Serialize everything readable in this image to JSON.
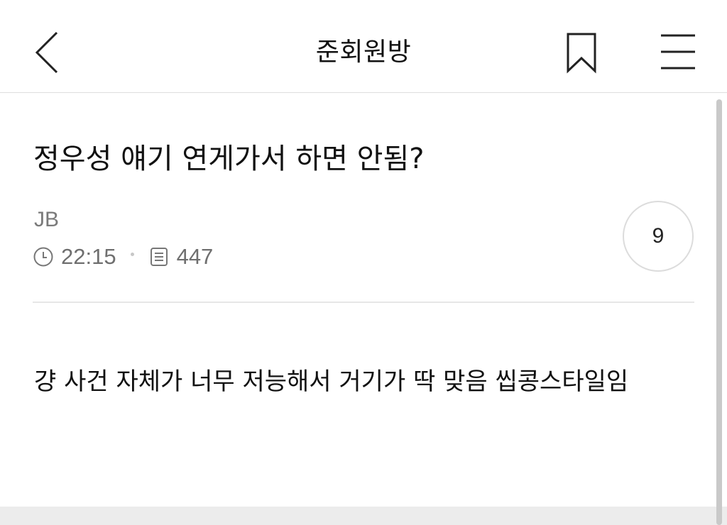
{
  "header": {
    "title": "준회원방",
    "back_icon": "chevron-left-icon",
    "bookmark_icon": "bookmark-icon",
    "menu_icon": "hamburger-menu-icon"
  },
  "post": {
    "title": "정우성 얘기 연게가서 하면 안됨?",
    "author": "JB",
    "time": "22:15",
    "views": "447",
    "comment_count": "9",
    "body": "걍 사건 자체가 너무 저능해서 거기가 딱 맞음 씹콩스타일임"
  },
  "icons": {
    "time": "clock-icon",
    "views": "document-icon"
  }
}
